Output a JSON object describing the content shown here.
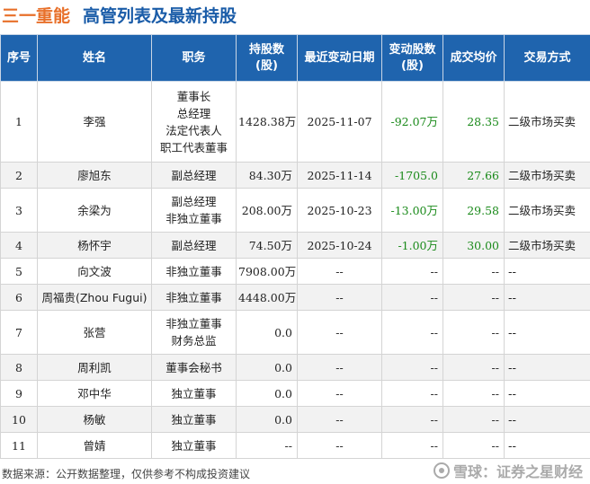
{
  "title": {
    "company": "三一重能",
    "main": "高管列表及最新持股"
  },
  "table": {
    "headers": [
      "序号",
      "姓名",
      "职务",
      "持股数\n(股)",
      "最近变动日期",
      "变动股数\n(股)",
      "成交均价",
      "交易方式"
    ],
    "rows": [
      {
        "no": "1",
        "name": "李强",
        "roles": [
          "董事长",
          "总经理",
          "法定代表人",
          "职工代表董事"
        ],
        "shares": "1428.38万",
        "date": "2025-11-07",
        "change": "-92.07万",
        "price": "28.35",
        "method": "二级市场买卖"
      },
      {
        "no": "2",
        "name": "廖旭东",
        "roles": [
          "副总经理"
        ],
        "shares": "84.30万",
        "date": "2025-11-14",
        "change": "-1705.0",
        "price": "27.66",
        "method": "二级市场买卖"
      },
      {
        "no": "3",
        "name": "余梁为",
        "roles": [
          "副总经理",
          "非独立董事"
        ],
        "shares": "208.00万",
        "date": "2025-10-23",
        "change": "-13.00万",
        "price": "29.58",
        "method": "二级市场买卖"
      },
      {
        "no": "4",
        "name": "杨怀宇",
        "roles": [
          "副总经理"
        ],
        "shares": "74.50万",
        "date": "2025-10-24",
        "change": "-1.00万",
        "price": "30.00",
        "method": "二级市场买卖"
      },
      {
        "no": "5",
        "name": "向文波",
        "roles": [
          "非独立董事"
        ],
        "shares": "7908.00万",
        "date": "--",
        "change": "--",
        "price": "--",
        "method": "--"
      },
      {
        "no": "6",
        "name": "周福贵(Zhou Fugui)",
        "roles": [
          "非独立董事"
        ],
        "shares": "4448.00万",
        "date": "--",
        "change": "--",
        "price": "--",
        "method": "--"
      },
      {
        "no": "7",
        "name": "张营",
        "roles": [
          "非独立董事",
          "财务总监"
        ],
        "shares": "0.0",
        "date": "--",
        "change": "--",
        "price": "--",
        "method": "--"
      },
      {
        "no": "8",
        "name": "周利凯",
        "roles": [
          "董事会秘书"
        ],
        "shares": "0.0",
        "date": "--",
        "change": "--",
        "price": "--",
        "method": "--"
      },
      {
        "no": "9",
        "name": "邓中华",
        "roles": [
          "独立董事"
        ],
        "shares": "0.0",
        "date": "--",
        "change": "--",
        "price": "--",
        "method": "--"
      },
      {
        "no": "10",
        "name": "杨敏",
        "roles": [
          "独立董事"
        ],
        "shares": "0.0",
        "date": "--",
        "change": "--",
        "price": "--",
        "method": "--"
      },
      {
        "no": "11",
        "name": "曾婧",
        "roles": [
          "独立董事"
        ],
        "shares": "--",
        "date": "--",
        "change": "--",
        "price": "--",
        "method": "--"
      }
    ]
  },
  "watermark": "证券之星",
  "footer": {
    "note": "数据来源：公开数据整理，仅供参考不构成投资建议",
    "brand": "雪球：证券之星财经"
  },
  "colors": {
    "header_bg": "#1f64ae",
    "title_company": "#e8702a",
    "title_main": "#1a5ca8",
    "positive_green": "#1a8a1a"
  }
}
